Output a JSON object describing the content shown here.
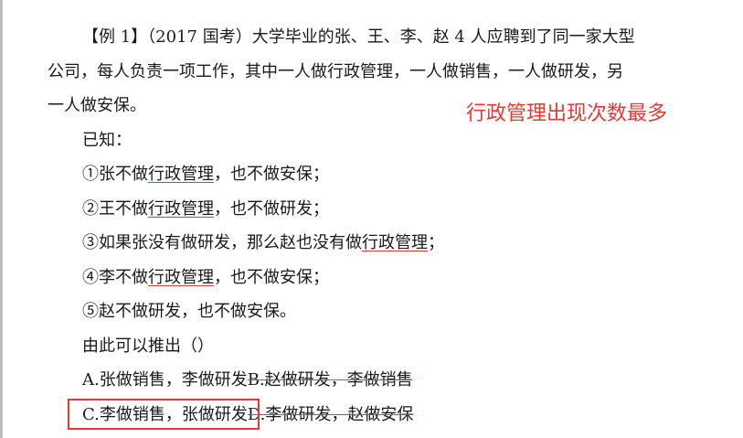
{
  "question": {
    "line1": "【例 1】（2017 国考）大学毕业的张、王、李、赵 4 人应聘到了同一家大型",
    "line2": "公司，每人负责一项工作，其中一人做行政管理，一人做销售，一人做研发，另",
    "line3": "一人做安保。",
    "known_label": "已知：",
    "c1_pre": "①张不做",
    "c1_key": "行政管理",
    "c1_post": "，也不做安保；",
    "c2_pre": "②王不做",
    "c2_key": "行政管理",
    "c2_post": "，也不做研发；",
    "c3_pre": "③如果张没有做研发，那么赵也没有做",
    "c3_key": "行政管理",
    "c3_post": "；",
    "c4_pre": "④李不做",
    "c4_key": "行政管理",
    "c4_post": "，也不做安保；",
    "c5": "⑤赵不做研发，也不做安保。",
    "prompt": "由此可以推出（）"
  },
  "options": {
    "a": "A.张做销售，李做研发",
    "b": "B.赵做研发，李做销售",
    "c": "C.李做销售，张做研发",
    "d": "D.李做研发，赵做安保"
  },
  "annotation": "行政管理出现次数最多",
  "colors": {
    "annotation": "#e53935",
    "text": "#1a1a1a"
  }
}
